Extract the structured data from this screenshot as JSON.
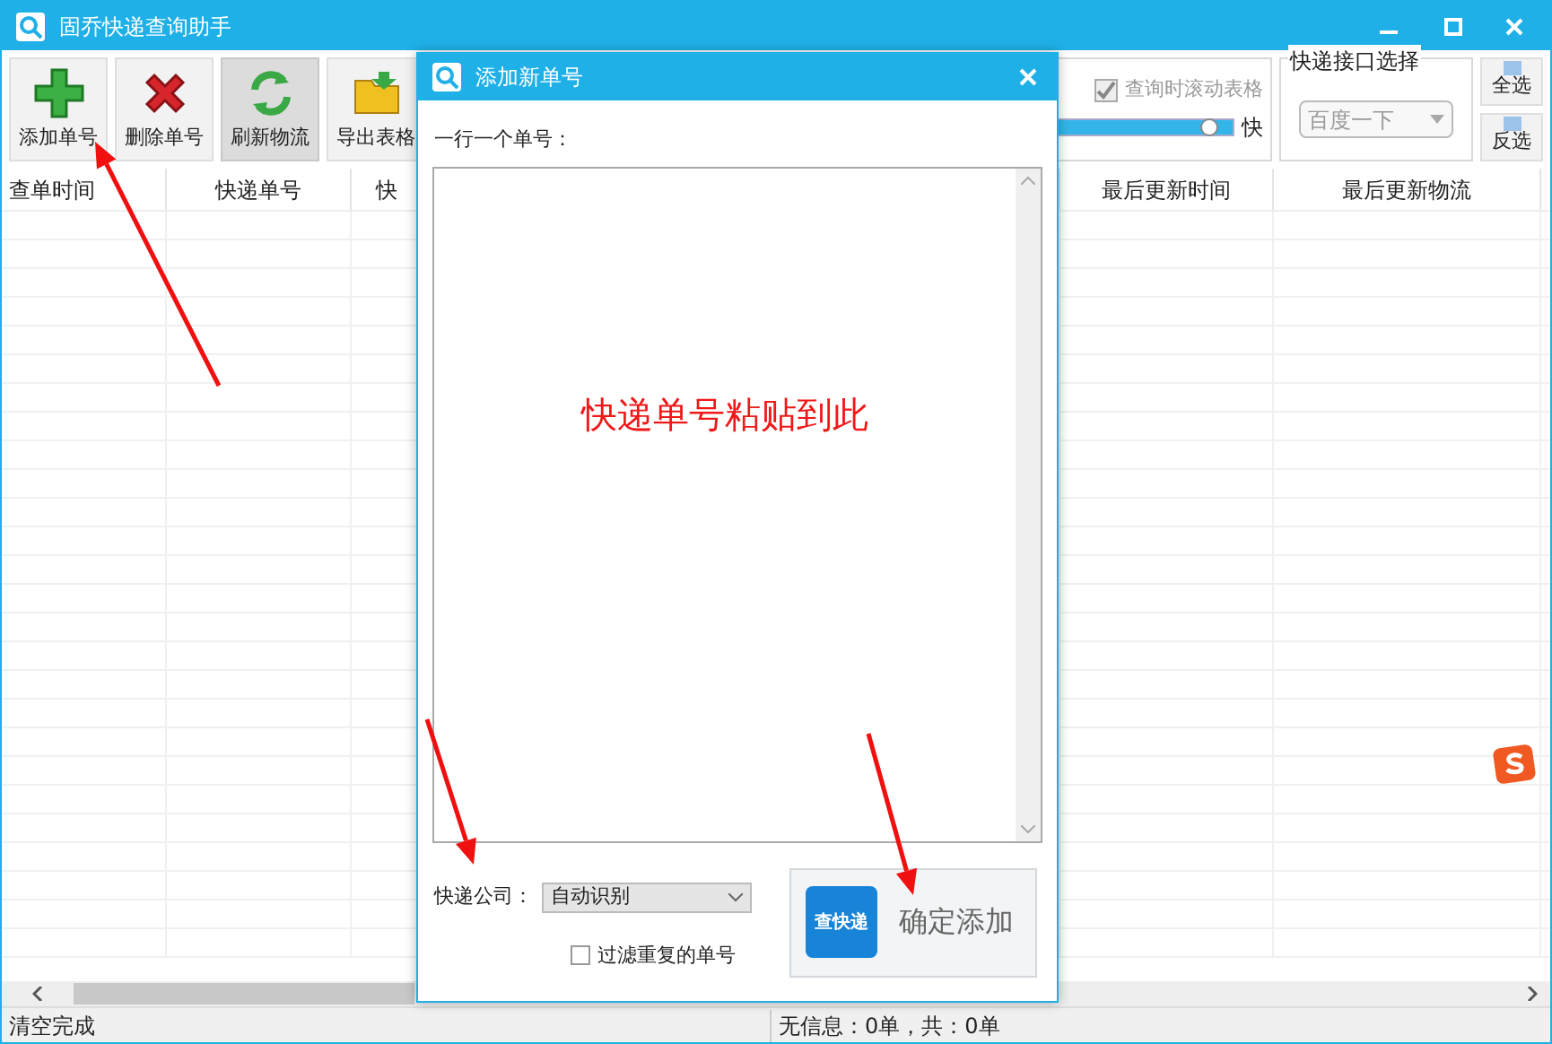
{
  "window": {
    "title": "固乔快递查询助手"
  },
  "toolbar": [
    {
      "label": "添加单号",
      "kind": "add",
      "selected": false
    },
    {
      "label": "删除单号",
      "kind": "delete",
      "selected": false
    },
    {
      "label": "刷新物流",
      "kind": "refresh",
      "selected": true
    },
    {
      "label": "导出表格",
      "kind": "export",
      "selected": false
    }
  ],
  "scroll_option": {
    "label": "查询时滚动表格",
    "checked": true,
    "disabled": true
  },
  "speed": {
    "level": 0.96,
    "label": "快"
  },
  "api_group": {
    "title": "快递接口选择",
    "value": "百度一下",
    "disabled": true
  },
  "side_buttons": [
    "全选",
    "反选"
  ],
  "table": {
    "columns": [
      "查单时间",
      "快递单号",
      "快",
      "最后更新时间",
      "最后更新物流"
    ]
  },
  "status_bar": [
    "清空完成",
    "无信息：0单，共：0单"
  ],
  "dialog": {
    "title": "添加新单号",
    "prompt": "一行一个单号：",
    "placeholder": "快递单号粘贴到此",
    "company_label": "快递公司：",
    "company_value": "自动识别",
    "filter": {
      "label": "过滤重复的单号",
      "checked": false
    },
    "submit": {
      "label": "确定添加",
      "logo_text": "查快递"
    }
  }
}
